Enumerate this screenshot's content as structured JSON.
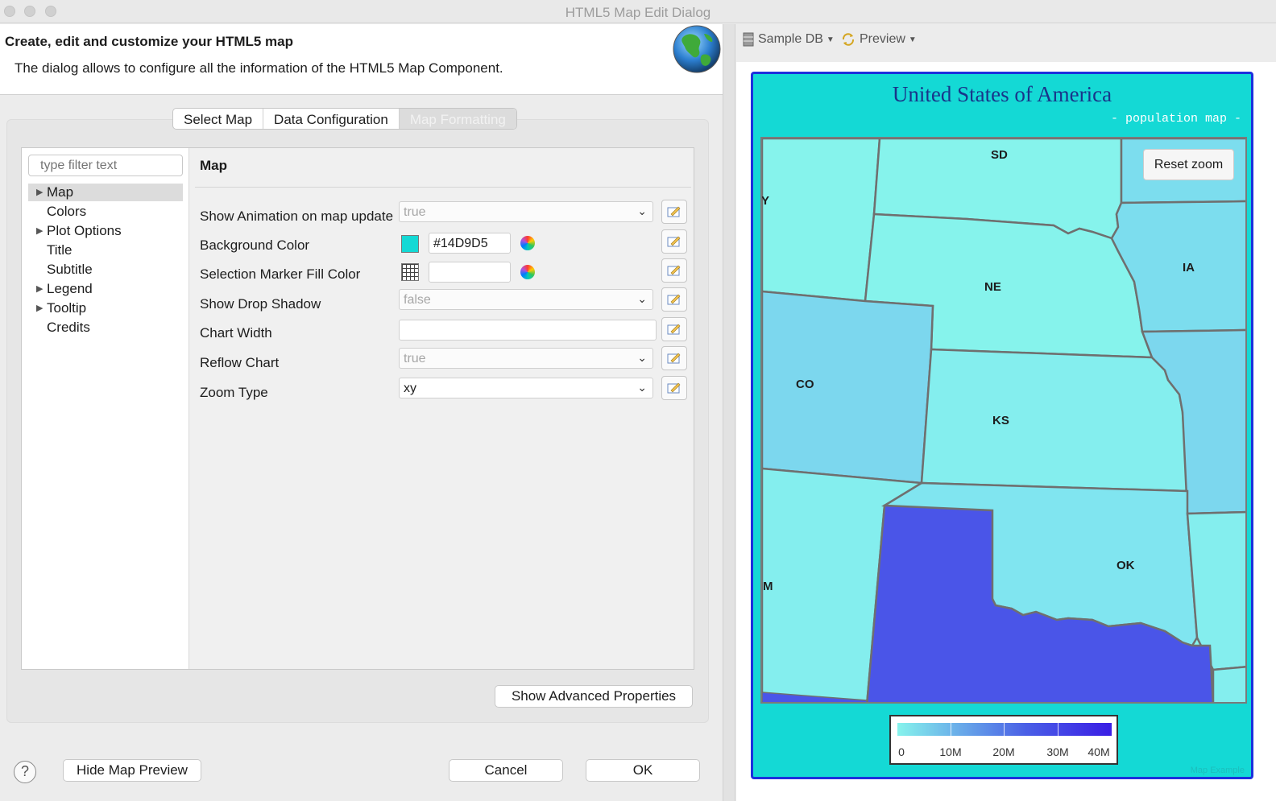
{
  "window": {
    "title": "HTML5 Map Edit Dialog"
  },
  "header": {
    "title": "Create, edit and customize your HTML5 map",
    "description": "The dialog allows to configure all the information of the HTML5 Map Component."
  },
  "tabs": [
    {
      "label": "Select Map"
    },
    {
      "label": "Data Configuration"
    },
    {
      "label": "Map Formatting",
      "active": true
    }
  ],
  "tree": {
    "filter_placeholder": "type filter text",
    "items": [
      {
        "label": "Map",
        "expandable": true,
        "selected": true
      },
      {
        "label": "Colors"
      },
      {
        "label": "Plot Options",
        "expandable": true
      },
      {
        "label": "Title"
      },
      {
        "label": "Subtitle"
      },
      {
        "label": "Legend",
        "expandable": true
      },
      {
        "label": "Tooltip",
        "expandable": true
      },
      {
        "label": "Credits"
      }
    ]
  },
  "properties": {
    "section_title": "Map",
    "rows": [
      {
        "label": "Show Animation on map update",
        "type": "combo",
        "value": "true"
      },
      {
        "label": "Background Color",
        "type": "color",
        "value": "#14D9D5"
      },
      {
        "label": "Selection Marker Fill Color",
        "type": "color",
        "value": ""
      },
      {
        "label": "Show Drop Shadow",
        "type": "combo",
        "value": "false"
      },
      {
        "label": "Chart Width",
        "type": "text",
        "value": ""
      },
      {
        "label": "Reflow Chart",
        "type": "combo",
        "value": "true"
      },
      {
        "label": "Zoom Type",
        "type": "combo",
        "value": "xy"
      }
    ]
  },
  "buttons": {
    "advanced": "Show Advanced Properties",
    "hide_preview": "Hide Map Preview",
    "cancel": "Cancel",
    "ok": "OK",
    "help": "?"
  },
  "preview_toolbar": {
    "datasource": "Sample DB",
    "preview": "Preview"
  },
  "map": {
    "title": "United States of America",
    "subtitle": "- population map -",
    "reset_zoom": "Reset zoom",
    "background": "#14D9D5",
    "credits": "Map Example",
    "state_labels": [
      "SD",
      "NE",
      "IA",
      "CO",
      "KS",
      "OK",
      "Y",
      "M"
    ],
    "legend": {
      "labels": [
        "0",
        "10M",
        "20M",
        "30M",
        "40M"
      ]
    }
  },
  "colors": {
    "accent_frame": "#1B30DD",
    "map_light": "#86F3EC",
    "map_mid": "#7CDDEE",
    "map_dark": "#4A55E8"
  }
}
